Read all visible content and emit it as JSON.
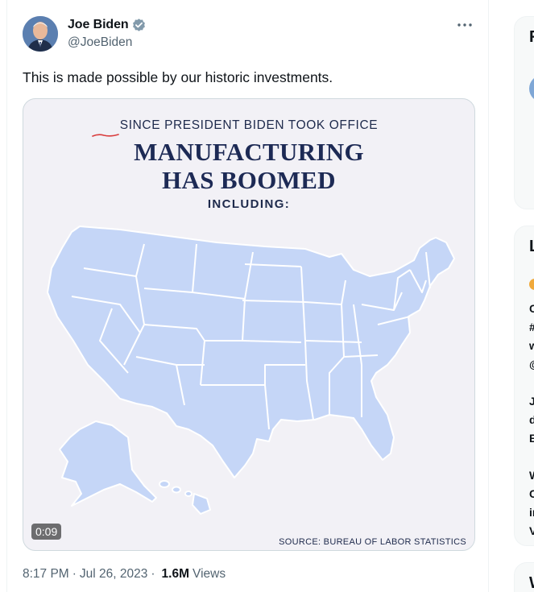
{
  "author": {
    "name": "Joe Biden",
    "handle": "@JoeBiden"
  },
  "tweet": {
    "text": "This is made possible by our historic investments.",
    "time": "8:17 PM",
    "date": "Jul 26, 2023",
    "views_count": "1.6M",
    "views_label": "Views"
  },
  "media": {
    "headline_top": "SINCE PRESIDENT BIDEN TOOK OFFICE",
    "headline_main_1": "MANUFACTURING",
    "headline_main_2": "HAS BOOMED",
    "headline_sub": "INCLUDING:",
    "source": "SOURCE: BUREAU OF LABOR STATISTICS",
    "duration": "0:09"
  },
  "sidebar": {
    "card1_letter": "F",
    "card2_letter": "L",
    "card2_lines": [
      "C",
      "#",
      "w",
      "@",
      "J",
      "d",
      "E",
      "W",
      "C",
      "ir",
      "V"
    ],
    "card3_letter": "W"
  },
  "colors": {
    "map_fill": "#c5d6f7",
    "headline": "#1d2a55",
    "accent_red": "#d93b3b",
    "verified": "#829aab"
  }
}
